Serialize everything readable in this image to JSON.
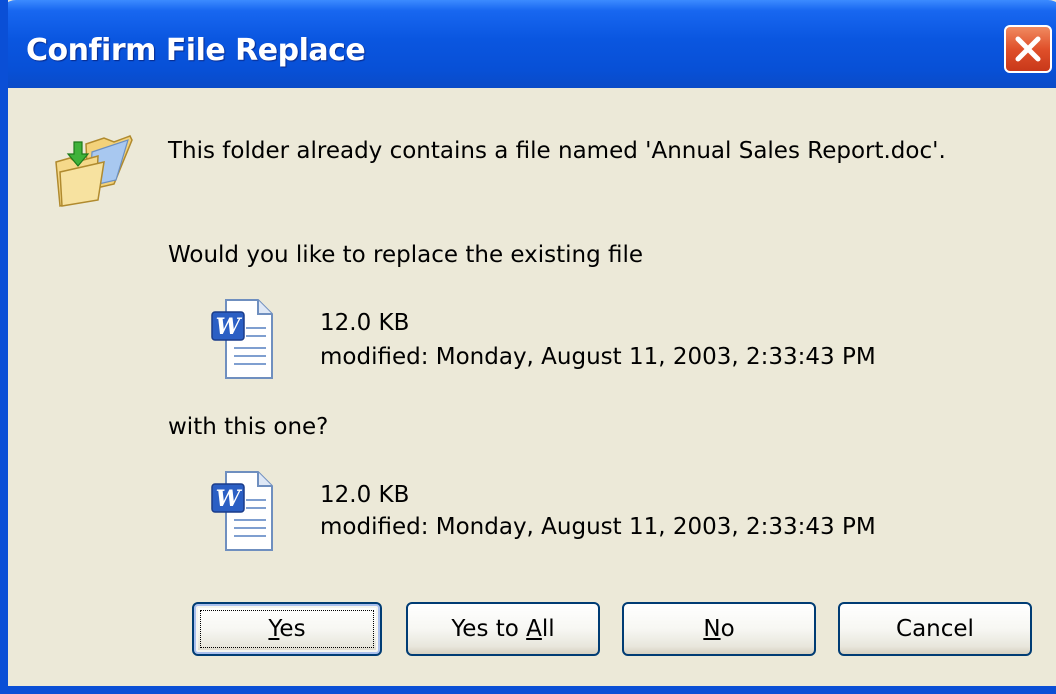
{
  "window": {
    "title": "Confirm File Replace"
  },
  "icons": {
    "title_close": "close-icon",
    "dialog_icon": "folder-replace-icon",
    "file_icon": "word-document-icon"
  },
  "message": {
    "line1": "This folder already contains a file named 'Annual Sales Report.doc'.",
    "line2": "Would you like to replace the existing file",
    "line3": "with this one?"
  },
  "existing_file": {
    "size": "12.0 KB",
    "modified": "modified: Monday, August 11, 2003, 2:33:43 PM"
  },
  "new_file": {
    "size": "12.0 KB",
    "modified": "modified: Monday, August 11, 2003, 2:33:43 PM"
  },
  "buttons": {
    "yes": {
      "mnemonic": "Y",
      "rest": "es"
    },
    "yes_to_all": {
      "prefix": "Yes to ",
      "mnemonic": "A",
      "rest": "ll"
    },
    "no": {
      "mnemonic": "N",
      "rest": "o"
    },
    "cancel": {
      "label": "Cancel"
    }
  },
  "colors": {
    "titlebar": "#0a56e0",
    "dialog_bg": "#ece9d8",
    "close_button": "#e0502a",
    "button_border": "#003c74"
  }
}
